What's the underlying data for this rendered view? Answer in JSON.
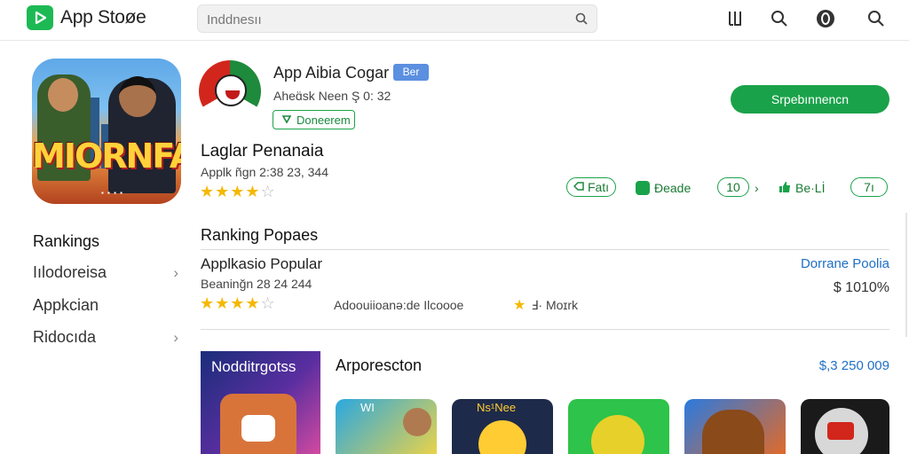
{
  "header": {
    "brand": "App Stoøe",
    "search_placeholder": "Inddnesıı",
    "icons": [
      "logo-play-icon",
      "search-icon",
      "bookmark-icon",
      "profile-icon",
      "search-icon"
    ]
  },
  "app": {
    "name": "App Aibia Cogar",
    "badge": "Ber",
    "subline": "Aheɑ̈sk Neen  Ş 0: 32",
    "tag": "Doneerem",
    "install_label": "Srpebınnencn"
  },
  "featured": {
    "title": "Laglar Penanaia",
    "meta": "Applk ñgn  2:38  23, 344",
    "rating": 4
  },
  "actions": {
    "fast_label": "Fatı",
    "upgrade_label": "Ðeade",
    "count_label": "10",
    "like_label": "Be·Lİ",
    "badge_label": "7ı"
  },
  "sidebar": {
    "title": "Rankings",
    "items": [
      {
        "label": "Iılodoreisa"
      },
      {
        "label": "Appkcian"
      },
      {
        "label": "Ridocıda"
      }
    ]
  },
  "ranking": {
    "header": "Ranking Popaes",
    "app_name": "Applkasio Popular",
    "meta": "Beaninğn  28  24  244",
    "rating": 4,
    "developer": "Adoouiioanə:de Ilcoooe",
    "feature": "Ⅎ· Moɪrk",
    "link": "Dorrane Poolia",
    "price": "$ 1010%"
  },
  "recommended": {
    "card_label": "Nodditrgotss",
    "title": "Arporescton",
    "price": "$,3 250 009",
    "tiles": [
      {
        "label": "WI",
        "color": "#3ab0e0"
      },
      {
        "label": "Ns¹Nee",
        "color": "#1e2a4a"
      },
      {
        "label": "",
        "color": "#2ec34a"
      },
      {
        "label": "",
        "color": "#e06a2a"
      },
      {
        "label": "",
        "color": "#1a1a1a"
      }
    ]
  },
  "colors": {
    "accent": "#1aa24a",
    "link": "#1f6fc4",
    "star": "#f5b800"
  }
}
